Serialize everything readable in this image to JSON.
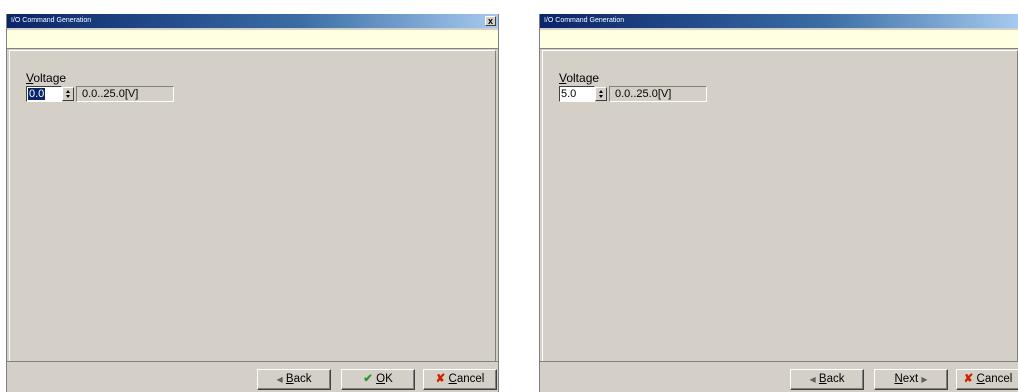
{
  "left_dialog": {
    "title": "I/O Command Generation",
    "close_label": "x",
    "voltage_label_accel": "V",
    "voltage_label_rest": "oltage",
    "voltage_value": "0.0",
    "voltage_range": "0.0..25.0[V]",
    "buttons": {
      "back_arrow": "◀",
      "back_accel": "B",
      "back_rest": "ack",
      "ok_icon": "✔",
      "ok_accel": "O",
      "ok_rest": "K",
      "cancel_icon": "✘",
      "cancel_accel": "C",
      "cancel_rest": "ancel"
    }
  },
  "right_dialog": {
    "title": "I/O Command Generation",
    "voltage_label_accel": "V",
    "voltage_label_rest": "oltage",
    "voltage_value": "5.0",
    "voltage_range": "0.0..25.0[V]",
    "buttons": {
      "back_arrow": "◀",
      "back_accel": "B",
      "back_rest": "ack",
      "next_accel": "N",
      "next_rest": "ext",
      "next_arrow": "▶",
      "cancel_icon": "✘",
      "cancel_accel": "C",
      "cancel_rest": "ancel"
    }
  }
}
